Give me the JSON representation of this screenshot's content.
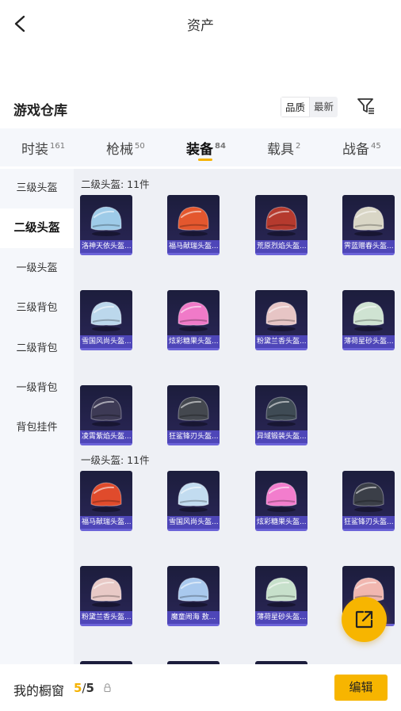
{
  "header": {
    "title": "资产"
  },
  "section": {
    "title": "游戏仓库",
    "sort_options": [
      "品质",
      "最新"
    ],
    "sort_active": 0
  },
  "tabs": [
    {
      "label": "时装",
      "count": "161"
    },
    {
      "label": "枪械",
      "count": "50"
    },
    {
      "label": "装备",
      "count": "84"
    },
    {
      "label": "载具",
      "count": "2"
    },
    {
      "label": "战备",
      "count": "45"
    }
  ],
  "sidebar": [
    {
      "label": "三级头盔"
    },
    {
      "label": "二级头盔"
    },
    {
      "label": "一级头盔"
    },
    {
      "label": "三级背包"
    },
    {
      "label": "二级背包"
    },
    {
      "label": "一级背包"
    },
    {
      "label": "背包挂件"
    }
  ],
  "groups": [
    {
      "label": "二级头盔: 11件",
      "items": [
        {
          "name": "洛神天依头盔...",
          "color": "#9ecbe8"
        },
        {
          "name": "福马献瑞头盔...",
          "color": "#e4572e"
        },
        {
          "name": "荒原烈焰头盔...",
          "color": "#b53a2e"
        },
        {
          "name": "霁蓝赠春头盔...",
          "color": "#d9d6c6"
        },
        {
          "name": "雪国风尚头盔...",
          "color": "#bcd8ec"
        },
        {
          "name": "炫彩糖果头盔...",
          "color": "#f07ac8"
        },
        {
          "name": "粉黛兰香头盔...",
          "color": "#e7c5c5"
        },
        {
          "name": "薄荷星砂头盔...",
          "color": "#cfe3d2"
        },
        {
          "name": "凌霄紫焰头盔...",
          "color": "#3d3a55"
        },
        {
          "name": "狂鲨锋刃头盔...",
          "color": "#44484f"
        },
        {
          "name": "异域锻装头盔...",
          "color": "#3f4b55"
        }
      ]
    },
    {
      "label": "一级头盔: 11件",
      "items": [
        {
          "name": "福马献瑞头盔...",
          "color": "#e04b2c"
        },
        {
          "name": "雪国风尚头盔...",
          "color": "#c2dcf0"
        },
        {
          "name": "炫彩糖果头盔...",
          "color": "#f27dcd"
        },
        {
          "name": "狂鲨锋刃头盔...",
          "color": "#3b3f48"
        },
        {
          "name": "粉黛兰香头盔...",
          "color": "#e8c9c6"
        },
        {
          "name": "魔童闹海 敖...",
          "color": "#a9c9ee"
        },
        {
          "name": "薄荷星砂头盔...",
          "color": "#c7e0cb"
        },
        {
          "name": "",
          "color": "#f1b7b0"
        },
        {
          "name": "",
          "color": "#2a2a40"
        },
        {
          "name": "",
          "color": "#2a2a40"
        },
        {
          "name": "",
          "color": "#2a2a40"
        }
      ]
    }
  ],
  "showcase": {
    "label": "我的橱窗",
    "current": "5",
    "separator": "/",
    "total": "5"
  },
  "edit_button": "编辑",
  "colors": {
    "accent": "#f7b500",
    "card_bg": "#1c1d3c",
    "card_label": "#4e46b8"
  }
}
